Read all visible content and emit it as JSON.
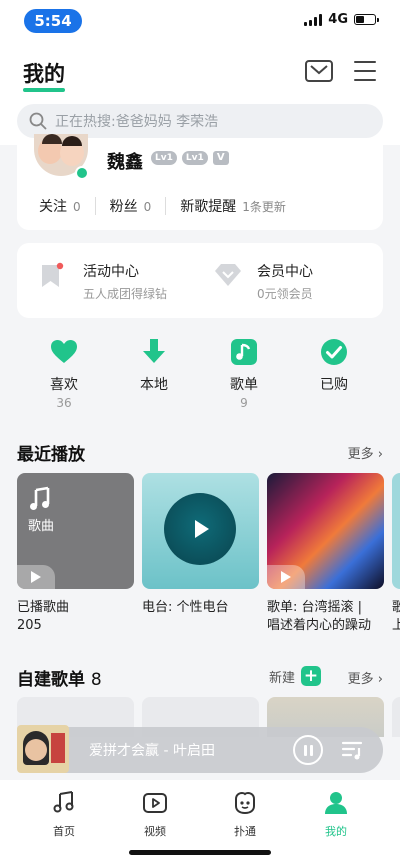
{
  "status": {
    "time": "5:54",
    "network": "4G",
    "battery_level": 0.45
  },
  "header": {
    "title": "我的",
    "search_placeholder": "正在热搜:爸爸妈妈 李荣浩"
  },
  "profile": {
    "name": "魏鑫",
    "level_badges": [
      "Lv1",
      "Lv1"
    ],
    "vip_badge": "V",
    "stats": [
      {
        "label": "关注",
        "value": "0"
      },
      {
        "label": "粉丝",
        "value": "0"
      },
      {
        "label": "新歌提醒",
        "value": "1条更新"
      }
    ]
  },
  "activities": [
    {
      "title": "活动中心",
      "subtitle": "五人成团得绿钻"
    },
    {
      "title": "会员中心",
      "subtitle": "0元领会员"
    }
  ],
  "shortcuts": [
    {
      "label": "喜欢",
      "count": "36",
      "icon": "heart-icon"
    },
    {
      "label": "本地",
      "count": "",
      "icon": "download-icon"
    },
    {
      "label": "歌单",
      "count": "9",
      "icon": "music-note-icon"
    },
    {
      "label": "已购",
      "count": "",
      "icon": "check-icon"
    }
  ],
  "recent": {
    "title": "最近播放",
    "more": "更多",
    "cards": [
      {
        "cover_label": "歌曲",
        "caption_line1": "已播歌曲",
        "caption_line2": "205"
      },
      {
        "cover_label": "",
        "caption_line1": "电台: 个性电台",
        "caption_line2": ""
      },
      {
        "cover_label": "",
        "caption_line1": "歌单: 台湾摇滚 |",
        "caption_line2": "唱述着内心的躁动"
      },
      {
        "cover_label": "",
        "caption_line1": "歌",
        "caption_line2": "上"
      }
    ]
  },
  "own_playlists": {
    "title": "自建歌单",
    "count": "8",
    "new_label": "新建",
    "more": "更多"
  },
  "player": {
    "now_playing": "爱拼才会赢 - 叶启田"
  },
  "tabs": [
    {
      "label": "首页",
      "icon": "home-music-icon"
    },
    {
      "label": "视频",
      "icon": "video-icon"
    },
    {
      "label": "扑通",
      "icon": "social-icon"
    },
    {
      "label": "我的",
      "icon": "profile-icon",
      "active": true
    }
  ],
  "colors": {
    "accent": "#21c48b",
    "time_pill": "#1a73e8"
  }
}
